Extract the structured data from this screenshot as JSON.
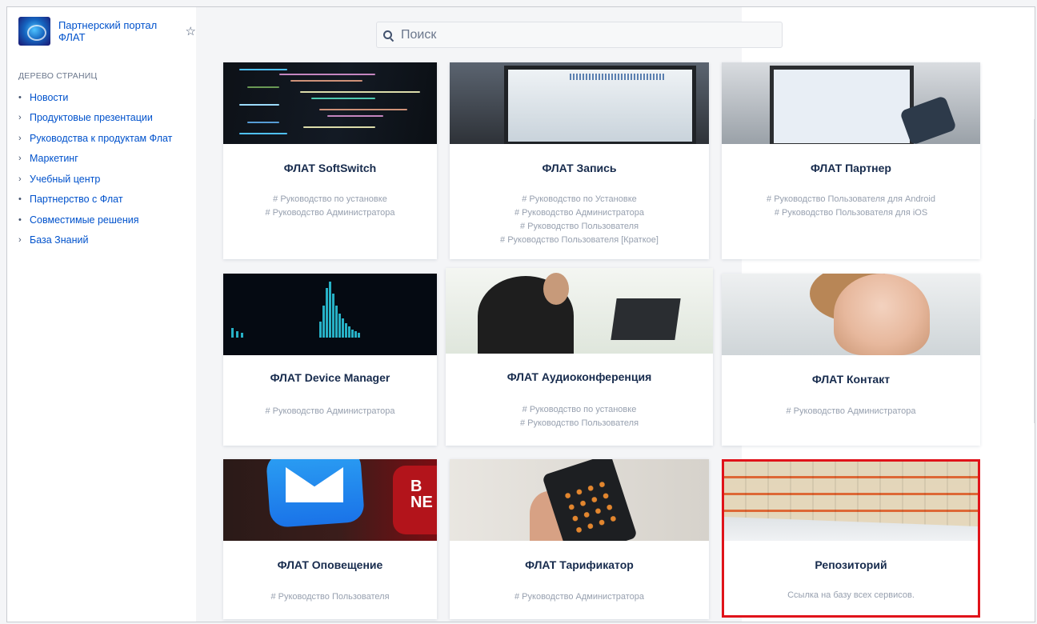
{
  "space": {
    "title": "Партнерский портал ФЛАТ"
  },
  "sidebar": {
    "tree_heading": "ДЕРЕВО СТРАНИЦ",
    "items": [
      {
        "marker": "•",
        "label": "Новости"
      },
      {
        "marker": "›",
        "label": "Продуктовые презентации"
      },
      {
        "marker": "›",
        "label": "Руководства к продуктам Флат"
      },
      {
        "marker": "›",
        "label": "Маркетинг"
      },
      {
        "marker": "›",
        "label": "Учебный центр"
      },
      {
        "marker": "•",
        "label": "Партнерство с Флат"
      },
      {
        "marker": "•",
        "label": "Совместимые решения"
      },
      {
        "marker": "›",
        "label": "База Знаний"
      }
    ]
  },
  "search": {
    "placeholder": "Поиск",
    "icon": "search-icon"
  },
  "cards": [
    {
      "image": "code",
      "title": "ФЛАТ SoftSwitch",
      "links": [
        "# Руководство по установке",
        "# Руководство Администратора"
      ]
    },
    {
      "image": "monitor",
      "title": "ФЛАТ Запись",
      "links": [
        "# Руководство по Установке",
        "# Руководство Администратора",
        "# Руководство Пользователя",
        "# Руководство Пользователя [Краткое]"
      ]
    },
    {
      "image": "laptop-phone",
      "title": "ФЛАТ Партнер",
      "links": [
        "# Руководство Пользователя для Android",
        "# Руководство Пользователя для iOS"
      ]
    },
    {
      "image": "chart",
      "title": "ФЛАТ Device Manager",
      "links": [
        "# Руководство Администратора"
      ]
    },
    {
      "image": "person-laptop",
      "title": "ФЛАТ Аудиоконференция",
      "links": [
        "# Руководство по установке",
        "# Руководство Пользователя"
      ]
    },
    {
      "image": "operator",
      "title": "ФЛАТ Контакт",
      "links": [
        "# Руководство Администратора"
      ]
    },
    {
      "image": "mail-app",
      "title": "ФЛАТ Оповещение",
      "links": [
        "# Руководство Пользователя"
      ]
    },
    {
      "image": "calculator",
      "title": "ФЛАТ Тарификатор",
      "links": [
        "# Руководство Администратора"
      ]
    },
    {
      "image": "warehouse",
      "title": "Репозиторий",
      "description": "Ссылка на базу всех сервисов.",
      "highlighted": true
    }
  ],
  "colors": {
    "link": "#0052cc",
    "highlight_border": "#e0131a",
    "muted_text": "#97a0af"
  }
}
